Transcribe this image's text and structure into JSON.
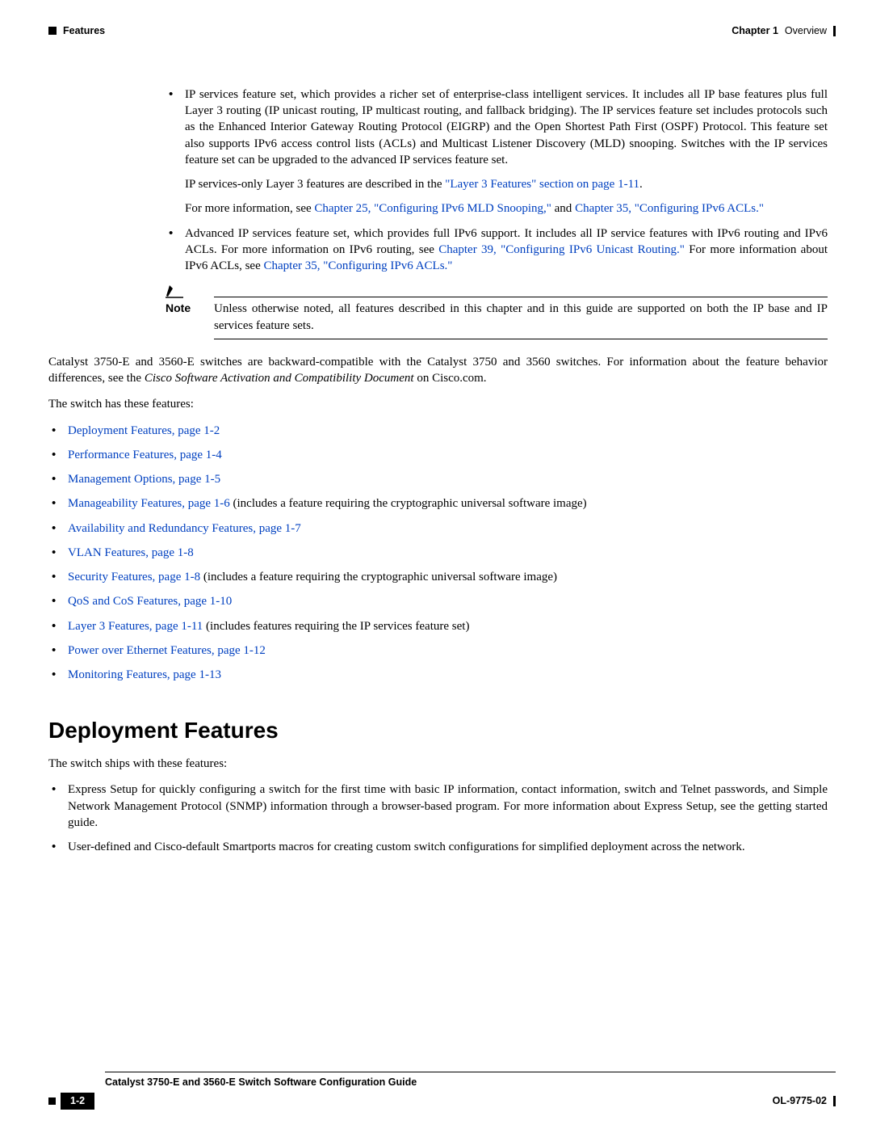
{
  "header": {
    "left_label": "Features",
    "chapter_label": "Chapter 1",
    "chapter_title": "Overview"
  },
  "bullet1": {
    "text": "IP services feature set, which provides a richer set of enterprise-class intelligent services. It includes all IP base features plus full Layer 3 routing (IP unicast routing, IP multicast routing, and fallback bridging). The IP services feature set includes protocols such as the Enhanced Interior Gateway Routing Protocol (EIGRP) and the Open Shortest Path First (OSPF) Protocol. This feature set also supports IPv6 access control lists (ACLs) and Multicast Listener Discovery (MLD) snooping. Switches with the IP services feature set can be upgraded to the advanced IP services feature set.",
    "p1_pre": "IP services-only Layer 3 features are described in the ",
    "p1_link": "\"Layer 3 Features\" section on page 1-11",
    "p1_post": ".",
    "p2_pre": "For more information, see ",
    "p2_link1": "Chapter 25, \"Configuring IPv6 MLD Snooping,\"",
    "p2_mid": " and ",
    "p2_link2": "Chapter 35, \"Configuring IPv6 ACLs.\""
  },
  "bullet2": {
    "pre": "Advanced IP services feature set, which provides full IPv6 support. It includes all IP service features with IPv6 routing and IPv6 ACLs. For more information on IPv6 routing, see ",
    "link1": "Chapter 39, \"Configuring IPv6 Unicast Routing.\"",
    "mid": " For more information about IPv6 ACLs, see ",
    "link2": "Chapter 35, \"Configuring IPv6 ACLs.\""
  },
  "note": {
    "label": "Note",
    "text": "Unless otherwise noted, all features described in this chapter and in this guide are supported on both the IP base and IP services feature sets."
  },
  "compat": {
    "p_pre": "Catalyst 3750-E and 3560-E switches are backward-compatible with the Catalyst 3750 and 3560 switches. For information about the feature behavior differences, see the ",
    "p_italic": "Cisco Software Activation and Compatibility Document",
    "p_post": " on Cisco.com."
  },
  "list_intro": "The switch has these features:",
  "features": [
    {
      "link": "Deployment Features, page 1-2",
      "suffix": ""
    },
    {
      "link": "Performance Features, page 1-4",
      "suffix": ""
    },
    {
      "link": "Management Options, page 1-5",
      "suffix": ""
    },
    {
      "link": "Manageability Features, page 1-6",
      "suffix": " (includes a feature requiring the cryptographic universal software image)"
    },
    {
      "link": "Availability and Redundancy Features, page 1-7",
      "suffix": ""
    },
    {
      "link": "VLAN Features, page 1-8",
      "suffix": ""
    },
    {
      "link": "Security Features, page 1-8",
      "suffix": " (includes a feature requiring the cryptographic universal software image)"
    },
    {
      "link": "QoS and CoS Features, page 1-10",
      "suffix": ""
    },
    {
      "link": "Layer 3 Features, page 1-11",
      "suffix": " (includes features requiring the IP services feature set)"
    },
    {
      "link": "Power over Ethernet Features, page 1-12",
      "suffix": ""
    },
    {
      "link": "Monitoring Features, page 1-13",
      "suffix": ""
    }
  ],
  "section_heading": "Deployment Features",
  "deploy_intro": "The switch ships with these features:",
  "deploy_bullets": [
    "Express Setup for quickly configuring a switch for the first time with basic IP information, contact information, switch and Telnet passwords, and Simple Network Management Protocol (SNMP) information through a browser-based program. For more information about Express Setup, see the getting started guide.",
    "User-defined and Cisco-default Smartports macros for creating custom switch configurations for simplified deployment across the network."
  ],
  "footer": {
    "guide_title": "Catalyst 3750-E and 3560-E Switch Software Configuration Guide",
    "page_num": "1-2",
    "doc_id": "OL-9775-02"
  }
}
